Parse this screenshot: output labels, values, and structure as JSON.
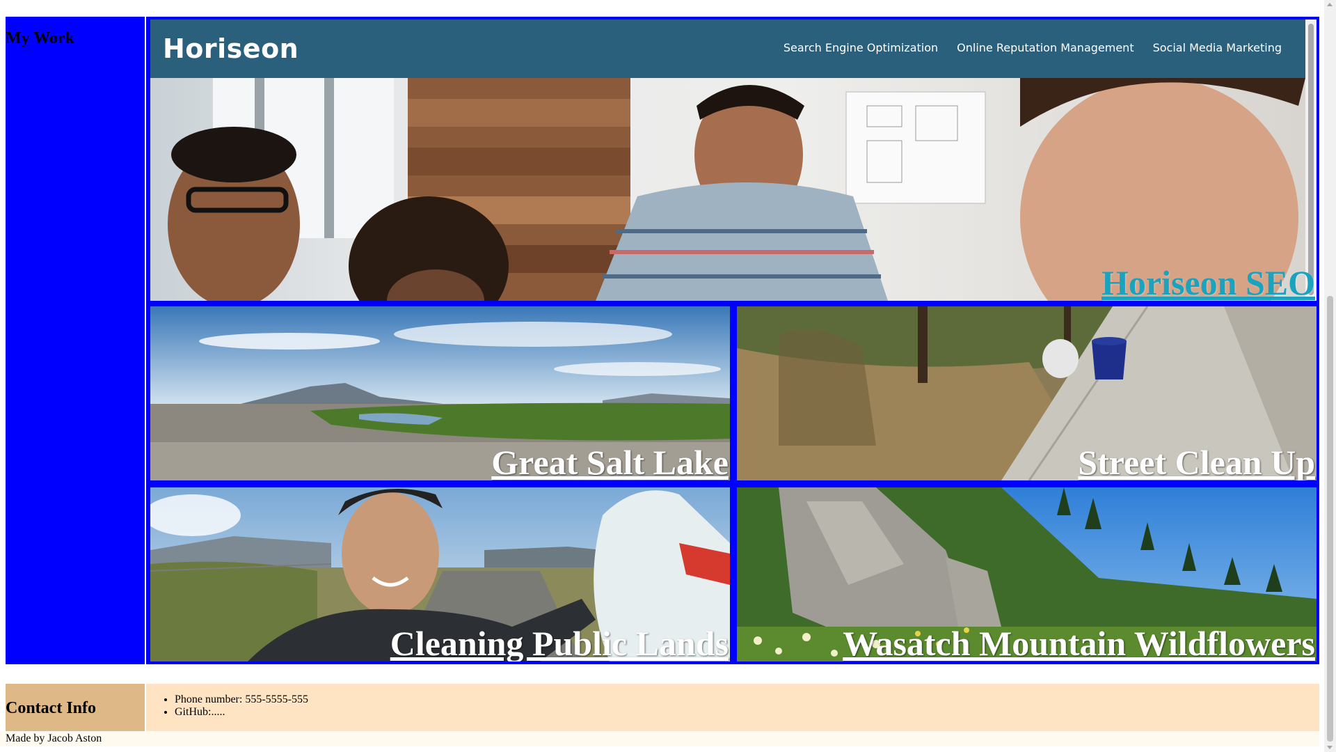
{
  "work": {
    "heading": "My Work",
    "seo": {
      "logo": "Horiseon",
      "nav": [
        "Search Engine Optimization",
        "Online Reputation Management",
        "Social Media Marketing"
      ],
      "label": "Horiseon SEO"
    },
    "tiles": [
      {
        "label": "Great Salt Lake"
      },
      {
        "label": "Street Clean Up"
      },
      {
        "label": "Cleaning Public Lands"
      },
      {
        "label": "Wasatch Mountain Wildflowers"
      }
    ]
  },
  "contact": {
    "heading": "Contact Info",
    "items": [
      "Phone number: 555-5555-555",
      "GitHub:....."
    ]
  },
  "footer": {
    "text": "Made by Jacob Aston"
  },
  "colors": {
    "section_bg": "#0000ff",
    "seo_header": "#2a607c",
    "contact_heading_bg": "#deb887",
    "contact_list_bg": "#ffe4c4",
    "seo_label": "#1aa3bf"
  }
}
